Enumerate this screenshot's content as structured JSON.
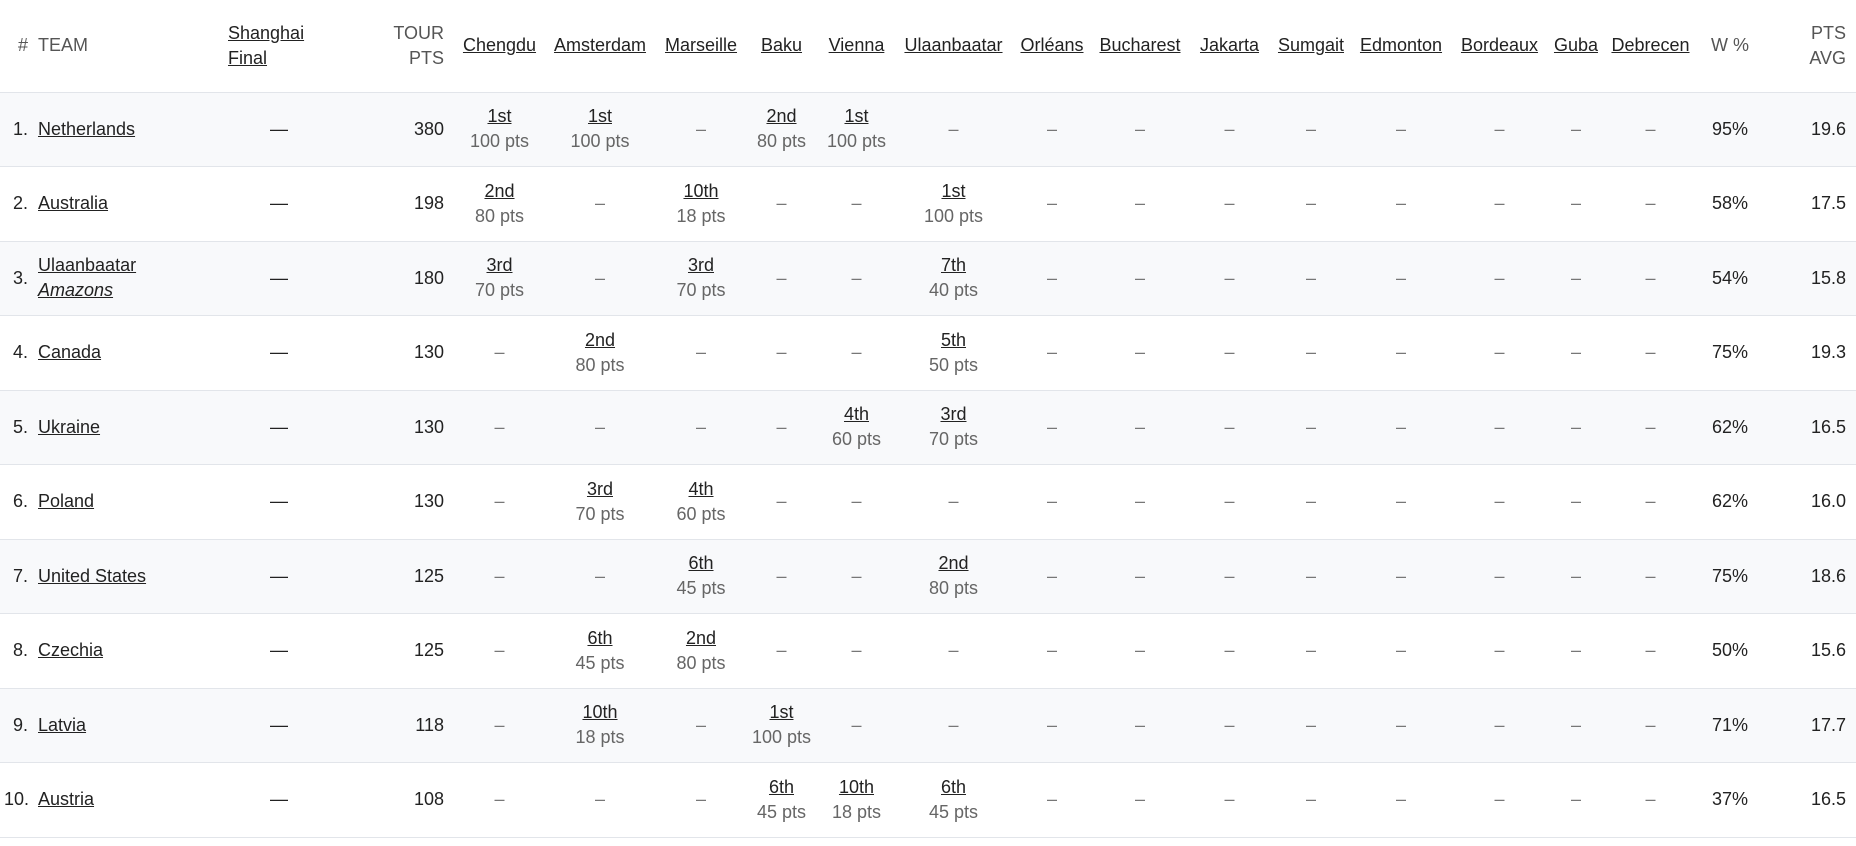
{
  "header": {
    "rank": "#",
    "team": "TEAM",
    "final_line1": "Shanghai",
    "final_line2": "Final",
    "tour_line1": "TOUR",
    "tour_line2": "PTS",
    "events": [
      "Chengdu",
      "Amsterdam",
      "Marseille",
      "Baku",
      "Vienna",
      "Ulaanbaatar",
      "Orléans",
      "Bucharest",
      "Jakarta",
      "Sumgait",
      "Edmonton",
      "Bordeaux",
      "Guba",
      "Debrecen"
    ],
    "win_pct": "W %",
    "avg_line1": "PTS",
    "avg_line2": "AVG"
  },
  "dash": "–",
  "final_dash": "—",
  "rows": [
    {
      "rank": "1.",
      "team": "Netherlands",
      "team_sub": "",
      "final": "—",
      "tour_pts": "380",
      "results": [
        {
          "place": "1st",
          "pts": "100 pts"
        },
        {
          "place": "1st",
          "pts": "100 pts"
        },
        null,
        {
          "place": "2nd",
          "pts": "80 pts"
        },
        {
          "place": "1st",
          "pts": "100 pts"
        },
        null,
        null,
        null,
        null,
        null,
        null,
        null,
        null,
        null
      ],
      "win_pct": "95%",
      "avg": "19.6"
    },
    {
      "rank": "2.",
      "team": "Australia",
      "team_sub": "",
      "final": "—",
      "tour_pts": "198",
      "results": [
        {
          "place": "2nd",
          "pts": "80 pts"
        },
        null,
        {
          "place": "10th",
          "pts": "18 pts"
        },
        null,
        null,
        {
          "place": "1st",
          "pts": "100 pts"
        },
        null,
        null,
        null,
        null,
        null,
        null,
        null,
        null
      ],
      "win_pct": "58%",
      "avg": "17.5"
    },
    {
      "rank": "3.",
      "team": "Ulaanbaatar",
      "team_sub": "Amazons",
      "final": "—",
      "tour_pts": "180",
      "results": [
        {
          "place": "3rd",
          "pts": "70 pts"
        },
        null,
        {
          "place": "3rd",
          "pts": "70 pts"
        },
        null,
        null,
        {
          "place": "7th",
          "pts": "40 pts"
        },
        null,
        null,
        null,
        null,
        null,
        null,
        null,
        null
      ],
      "win_pct": "54%",
      "avg": "15.8"
    },
    {
      "rank": "4.",
      "team": "Canada",
      "team_sub": "",
      "final": "—",
      "tour_pts": "130",
      "results": [
        null,
        {
          "place": "2nd",
          "pts": "80 pts"
        },
        null,
        null,
        null,
        {
          "place": "5th",
          "pts": "50 pts"
        },
        null,
        null,
        null,
        null,
        null,
        null,
        null,
        null
      ],
      "win_pct": "75%",
      "avg": "19.3"
    },
    {
      "rank": "5.",
      "team": "Ukraine",
      "team_sub": "",
      "final": "—",
      "tour_pts": "130",
      "results": [
        null,
        null,
        null,
        null,
        {
          "place": "4th",
          "pts": "60 pts"
        },
        {
          "place": "3rd",
          "pts": "70 pts"
        },
        null,
        null,
        null,
        null,
        null,
        null,
        null,
        null
      ],
      "win_pct": "62%",
      "avg": "16.5"
    },
    {
      "rank": "6.",
      "team": "Poland",
      "team_sub": "",
      "final": "—",
      "tour_pts": "130",
      "results": [
        null,
        {
          "place": "3rd",
          "pts": "70 pts"
        },
        {
          "place": "4th",
          "pts": "60 pts"
        },
        null,
        null,
        null,
        null,
        null,
        null,
        null,
        null,
        null,
        null,
        null
      ],
      "win_pct": "62%",
      "avg": "16.0"
    },
    {
      "rank": "7.",
      "team": "United States",
      "team_sub": "",
      "final": "—",
      "tour_pts": "125",
      "results": [
        null,
        null,
        {
          "place": "6th",
          "pts": "45 pts"
        },
        null,
        null,
        {
          "place": "2nd",
          "pts": "80 pts"
        },
        null,
        null,
        null,
        null,
        null,
        null,
        null,
        null
      ],
      "win_pct": "75%",
      "avg": "18.6"
    },
    {
      "rank": "8.",
      "team": "Czechia",
      "team_sub": "",
      "final": "—",
      "tour_pts": "125",
      "results": [
        null,
        {
          "place": "6th",
          "pts": "45 pts"
        },
        {
          "place": "2nd",
          "pts": "80 pts"
        },
        null,
        null,
        null,
        null,
        null,
        null,
        null,
        null,
        null,
        null,
        null
      ],
      "win_pct": "50%",
      "avg": "15.6"
    },
    {
      "rank": "9.",
      "team": "Latvia",
      "team_sub": "",
      "final": "—",
      "tour_pts": "118",
      "results": [
        null,
        {
          "place": "10th",
          "pts": "18 pts"
        },
        null,
        {
          "place": "1st",
          "pts": "100 pts"
        },
        null,
        null,
        null,
        null,
        null,
        null,
        null,
        null,
        null,
        null
      ],
      "win_pct": "71%",
      "avg": "17.7"
    },
    {
      "rank": "10.",
      "team": "Austria",
      "team_sub": "",
      "final": "—",
      "tour_pts": "108",
      "results": [
        null,
        null,
        null,
        {
          "place": "6th",
          "pts": "45 pts"
        },
        {
          "place": "10th",
          "pts": "18 pts"
        },
        {
          "place": "6th",
          "pts": "45 pts"
        },
        null,
        null,
        null,
        null,
        null,
        null,
        null,
        null
      ],
      "win_pct": "37%",
      "avg": "16.5"
    }
  ]
}
